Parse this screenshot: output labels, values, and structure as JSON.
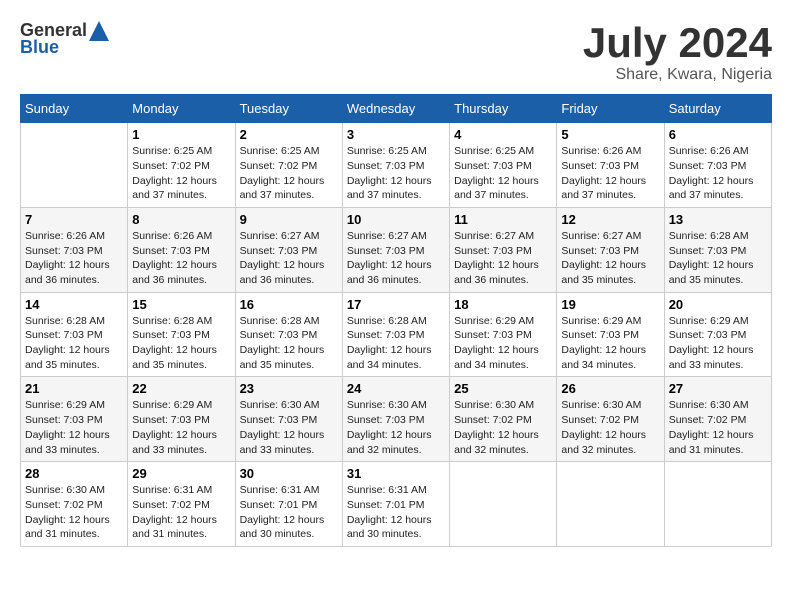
{
  "header": {
    "logo_general": "General",
    "logo_blue": "Blue",
    "month_year": "July 2024",
    "location": "Share, Kwara, Nigeria"
  },
  "days_of_week": [
    "Sunday",
    "Monday",
    "Tuesday",
    "Wednesday",
    "Thursday",
    "Friday",
    "Saturday"
  ],
  "weeks": [
    [
      {
        "day": "",
        "info": ""
      },
      {
        "day": "1",
        "info": "Sunrise: 6:25 AM\nSunset: 7:02 PM\nDaylight: 12 hours\nand 37 minutes."
      },
      {
        "day": "2",
        "info": "Sunrise: 6:25 AM\nSunset: 7:02 PM\nDaylight: 12 hours\nand 37 minutes."
      },
      {
        "day": "3",
        "info": "Sunrise: 6:25 AM\nSunset: 7:03 PM\nDaylight: 12 hours\nand 37 minutes."
      },
      {
        "day": "4",
        "info": "Sunrise: 6:25 AM\nSunset: 7:03 PM\nDaylight: 12 hours\nand 37 minutes."
      },
      {
        "day": "5",
        "info": "Sunrise: 6:26 AM\nSunset: 7:03 PM\nDaylight: 12 hours\nand 37 minutes."
      },
      {
        "day": "6",
        "info": "Sunrise: 6:26 AM\nSunset: 7:03 PM\nDaylight: 12 hours\nand 37 minutes."
      }
    ],
    [
      {
        "day": "7",
        "info": "Sunrise: 6:26 AM\nSunset: 7:03 PM\nDaylight: 12 hours\nand 36 minutes."
      },
      {
        "day": "8",
        "info": "Sunrise: 6:26 AM\nSunset: 7:03 PM\nDaylight: 12 hours\nand 36 minutes."
      },
      {
        "day": "9",
        "info": "Sunrise: 6:27 AM\nSunset: 7:03 PM\nDaylight: 12 hours\nand 36 minutes."
      },
      {
        "day": "10",
        "info": "Sunrise: 6:27 AM\nSunset: 7:03 PM\nDaylight: 12 hours\nand 36 minutes."
      },
      {
        "day": "11",
        "info": "Sunrise: 6:27 AM\nSunset: 7:03 PM\nDaylight: 12 hours\nand 36 minutes."
      },
      {
        "day": "12",
        "info": "Sunrise: 6:27 AM\nSunset: 7:03 PM\nDaylight: 12 hours\nand 35 minutes."
      },
      {
        "day": "13",
        "info": "Sunrise: 6:28 AM\nSunset: 7:03 PM\nDaylight: 12 hours\nand 35 minutes."
      }
    ],
    [
      {
        "day": "14",
        "info": "Sunrise: 6:28 AM\nSunset: 7:03 PM\nDaylight: 12 hours\nand 35 minutes."
      },
      {
        "day": "15",
        "info": "Sunrise: 6:28 AM\nSunset: 7:03 PM\nDaylight: 12 hours\nand 35 minutes."
      },
      {
        "day": "16",
        "info": "Sunrise: 6:28 AM\nSunset: 7:03 PM\nDaylight: 12 hours\nand 35 minutes."
      },
      {
        "day": "17",
        "info": "Sunrise: 6:28 AM\nSunset: 7:03 PM\nDaylight: 12 hours\nand 34 minutes."
      },
      {
        "day": "18",
        "info": "Sunrise: 6:29 AM\nSunset: 7:03 PM\nDaylight: 12 hours\nand 34 minutes."
      },
      {
        "day": "19",
        "info": "Sunrise: 6:29 AM\nSunset: 7:03 PM\nDaylight: 12 hours\nand 34 minutes."
      },
      {
        "day": "20",
        "info": "Sunrise: 6:29 AM\nSunset: 7:03 PM\nDaylight: 12 hours\nand 33 minutes."
      }
    ],
    [
      {
        "day": "21",
        "info": "Sunrise: 6:29 AM\nSunset: 7:03 PM\nDaylight: 12 hours\nand 33 minutes."
      },
      {
        "day": "22",
        "info": "Sunrise: 6:29 AM\nSunset: 7:03 PM\nDaylight: 12 hours\nand 33 minutes."
      },
      {
        "day": "23",
        "info": "Sunrise: 6:30 AM\nSunset: 7:03 PM\nDaylight: 12 hours\nand 33 minutes."
      },
      {
        "day": "24",
        "info": "Sunrise: 6:30 AM\nSunset: 7:03 PM\nDaylight: 12 hours\nand 32 minutes."
      },
      {
        "day": "25",
        "info": "Sunrise: 6:30 AM\nSunset: 7:02 PM\nDaylight: 12 hours\nand 32 minutes."
      },
      {
        "day": "26",
        "info": "Sunrise: 6:30 AM\nSunset: 7:02 PM\nDaylight: 12 hours\nand 32 minutes."
      },
      {
        "day": "27",
        "info": "Sunrise: 6:30 AM\nSunset: 7:02 PM\nDaylight: 12 hours\nand 31 minutes."
      }
    ],
    [
      {
        "day": "28",
        "info": "Sunrise: 6:30 AM\nSunset: 7:02 PM\nDaylight: 12 hours\nand 31 minutes."
      },
      {
        "day": "29",
        "info": "Sunrise: 6:31 AM\nSunset: 7:02 PM\nDaylight: 12 hours\nand 31 minutes."
      },
      {
        "day": "30",
        "info": "Sunrise: 6:31 AM\nSunset: 7:01 PM\nDaylight: 12 hours\nand 30 minutes."
      },
      {
        "day": "31",
        "info": "Sunrise: 6:31 AM\nSunset: 7:01 PM\nDaylight: 12 hours\nand 30 minutes."
      },
      {
        "day": "",
        "info": ""
      },
      {
        "day": "",
        "info": ""
      },
      {
        "day": "",
        "info": ""
      }
    ]
  ]
}
